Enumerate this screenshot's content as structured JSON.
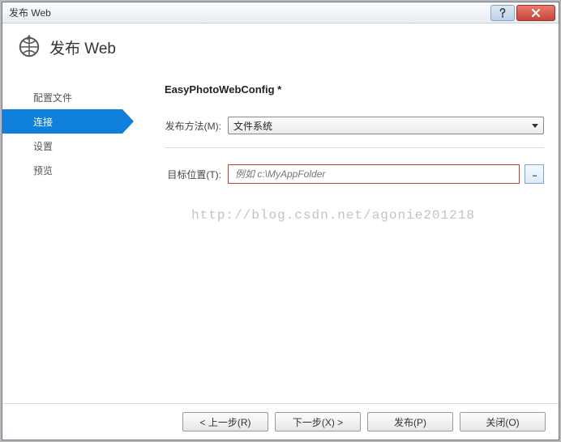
{
  "titlebar": {
    "title": "发布 Web"
  },
  "header": {
    "title": "发布 Web"
  },
  "sidebar": {
    "items": [
      {
        "label": "配置文件"
      },
      {
        "label": "连接"
      },
      {
        "label": "设置"
      },
      {
        "label": "预览"
      }
    ],
    "active_index": 1
  },
  "content": {
    "config_title": "EasyPhotoWebConfig *",
    "publish_method_label": "发布方法(M):",
    "publish_method_value": "文件系统",
    "target_location_label": "目标位置(T):",
    "target_location_value": "",
    "target_location_placeholder": "例如 c:\\MyAppFolder",
    "browse_label": "...",
    "watermark": "http://blog.csdn.net/agonie201218"
  },
  "footer": {
    "prev": "< 上一步(R)",
    "next": "下一步(X) >",
    "publish": "发布(P)",
    "close": "关闭(O)"
  }
}
